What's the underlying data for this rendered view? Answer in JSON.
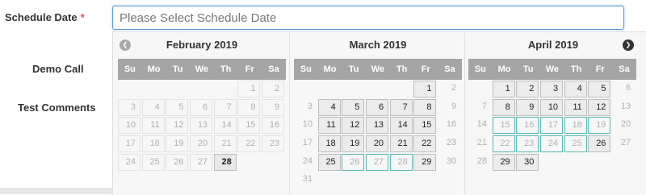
{
  "form": {
    "schedule_label": "Schedule Date",
    "required_mark": "*",
    "schedule_placeholder": "Please Select Schedule Date",
    "demo_label": "Demo Call",
    "comments_label": "Test Comments"
  },
  "datepicker": {
    "weekdays": [
      "Su",
      "Mo",
      "Tu",
      "We",
      "Th",
      "Fr",
      "Sa"
    ],
    "prev_icon": "chevron-left-circle-icon",
    "next_icon": "chevron-right-circle-icon",
    "months": [
      {
        "title": "February 2019",
        "weeks": [
          [
            null,
            null,
            null,
            null,
            null,
            {
              "d": "1",
              "s": "dis"
            },
            {
              "d": "2",
              "s": "dis"
            }
          ],
          [
            {
              "d": "3",
              "s": "dis"
            },
            {
              "d": "4",
              "s": "dis"
            },
            {
              "d": "5",
              "s": "dis"
            },
            {
              "d": "6",
              "s": "dis"
            },
            {
              "d": "7",
              "s": "dis"
            },
            {
              "d": "8",
              "s": "dis"
            },
            {
              "d": "9",
              "s": "dis"
            }
          ],
          [
            {
              "d": "10",
              "s": "dis"
            },
            {
              "d": "11",
              "s": "dis"
            },
            {
              "d": "12",
              "s": "dis"
            },
            {
              "d": "13",
              "s": "dis"
            },
            {
              "d": "14",
              "s": "dis"
            },
            {
              "d": "15",
              "s": "dis"
            },
            {
              "d": "16",
              "s": "dis"
            }
          ],
          [
            {
              "d": "17",
              "s": "dis"
            },
            {
              "d": "18",
              "s": "dis"
            },
            {
              "d": "19",
              "s": "dis"
            },
            {
              "d": "20",
              "s": "dis"
            },
            {
              "d": "21",
              "s": "dis"
            },
            {
              "d": "22",
              "s": "dis"
            },
            {
              "d": "23",
              "s": "dis"
            }
          ],
          [
            {
              "d": "24",
              "s": "dis"
            },
            {
              "d": "25",
              "s": "dis"
            },
            {
              "d": "26",
              "s": "dis"
            },
            {
              "d": "27",
              "s": "dis"
            },
            {
              "d": "28",
              "s": "sel"
            },
            null,
            null
          ]
        ]
      },
      {
        "title": "March 2019",
        "weeks": [
          [
            null,
            null,
            null,
            null,
            null,
            {
              "d": "1",
              "s": "act"
            },
            {
              "d": "2",
              "s": "wkend"
            }
          ],
          [
            {
              "d": "3",
              "s": "wkend"
            },
            {
              "d": "4",
              "s": "act"
            },
            {
              "d": "5",
              "s": "act"
            },
            {
              "d": "6",
              "s": "act"
            },
            {
              "d": "7",
              "s": "act"
            },
            {
              "d": "8",
              "s": "act"
            },
            {
              "d": "9",
              "s": "wkend"
            }
          ],
          [
            {
              "d": "10",
              "s": "wkend"
            },
            {
              "d": "11",
              "s": "act"
            },
            {
              "d": "12",
              "s": "act"
            },
            {
              "d": "13",
              "s": "act"
            },
            {
              "d": "14",
              "s": "act"
            },
            {
              "d": "15",
              "s": "act"
            },
            {
              "d": "16",
              "s": "wkend"
            }
          ],
          [
            {
              "d": "17",
              "s": "wkend"
            },
            {
              "d": "18",
              "s": "act"
            },
            {
              "d": "19",
              "s": "act"
            },
            {
              "d": "20",
              "s": "act"
            },
            {
              "d": "21",
              "s": "act"
            },
            {
              "d": "22",
              "s": "act"
            },
            {
              "d": "23",
              "s": "wkend"
            }
          ],
          [
            {
              "d": "24",
              "s": "wkend"
            },
            {
              "d": "25",
              "s": "act"
            },
            {
              "d": "26",
              "s": "hl"
            },
            {
              "d": "27",
              "s": "hl"
            },
            {
              "d": "28",
              "s": "hl"
            },
            {
              "d": "29",
              "s": "act"
            },
            {
              "d": "30",
              "s": "wkend"
            }
          ],
          [
            {
              "d": "31",
              "s": "wkend"
            },
            null,
            null,
            null,
            null,
            null,
            null
          ]
        ]
      },
      {
        "title": "April 2019",
        "weeks": [
          [
            null,
            {
              "d": "1",
              "s": "act"
            },
            {
              "d": "2",
              "s": "act"
            },
            {
              "d": "3",
              "s": "act"
            },
            {
              "d": "4",
              "s": "act"
            },
            {
              "d": "5",
              "s": "act"
            },
            {
              "d": "6",
              "s": "wkend"
            }
          ],
          [
            {
              "d": "7",
              "s": "wkend"
            },
            {
              "d": "8",
              "s": "act"
            },
            {
              "d": "9",
              "s": "act"
            },
            {
              "d": "10",
              "s": "act"
            },
            {
              "d": "11",
              "s": "act"
            },
            {
              "d": "12",
              "s": "act"
            },
            {
              "d": "13",
              "s": "wkend"
            }
          ],
          [
            {
              "d": "14",
              "s": "wkend"
            },
            {
              "d": "15",
              "s": "hl"
            },
            {
              "d": "16",
              "s": "hl"
            },
            {
              "d": "17",
              "s": "hl"
            },
            {
              "d": "18",
              "s": "hl"
            },
            {
              "d": "19",
              "s": "hl"
            },
            {
              "d": "20",
              "s": "wkend"
            }
          ],
          [
            {
              "d": "21",
              "s": "wkend"
            },
            {
              "d": "22",
              "s": "hl"
            },
            {
              "d": "23",
              "s": "hl"
            },
            {
              "d": "24",
              "s": "hl"
            },
            {
              "d": "25",
              "s": "hl"
            },
            {
              "d": "26",
              "s": "act"
            },
            {
              "d": "27",
              "s": "wkend"
            }
          ],
          [
            {
              "d": "28",
              "s": "wkend"
            },
            {
              "d": "29",
              "s": "act"
            },
            {
              "d": "30",
              "s": "act"
            },
            null,
            null,
            null,
            null
          ]
        ]
      }
    ]
  }
}
